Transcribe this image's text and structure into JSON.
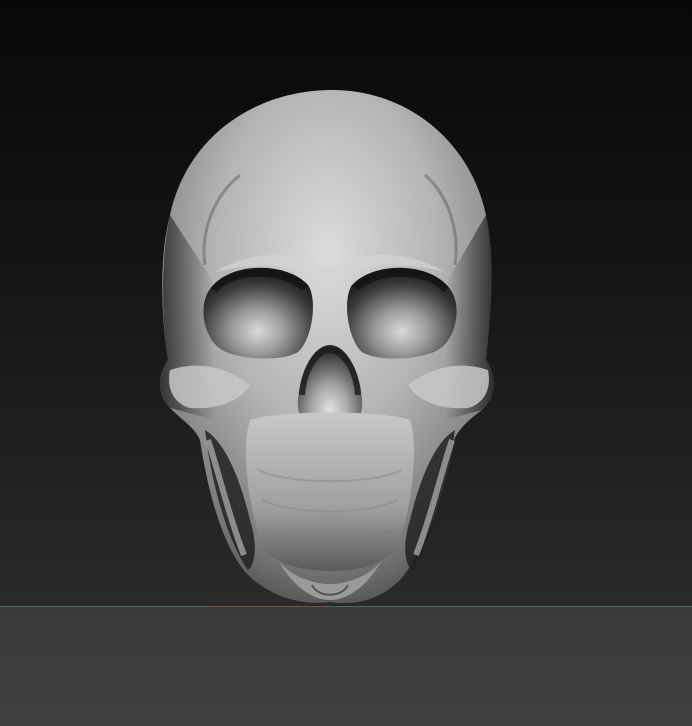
{
  "viewport": {
    "subject": "skull-3d-mesh",
    "background_color_top": "#080808",
    "background_color_bottom": "#2c2c2c",
    "floor_color": "#3d3d3d",
    "grid_axis_colors": {
      "horizon": "#4f6a4f",
      "x_axis": "#8a4a3a"
    },
    "material_color": "#bdbdbd"
  }
}
